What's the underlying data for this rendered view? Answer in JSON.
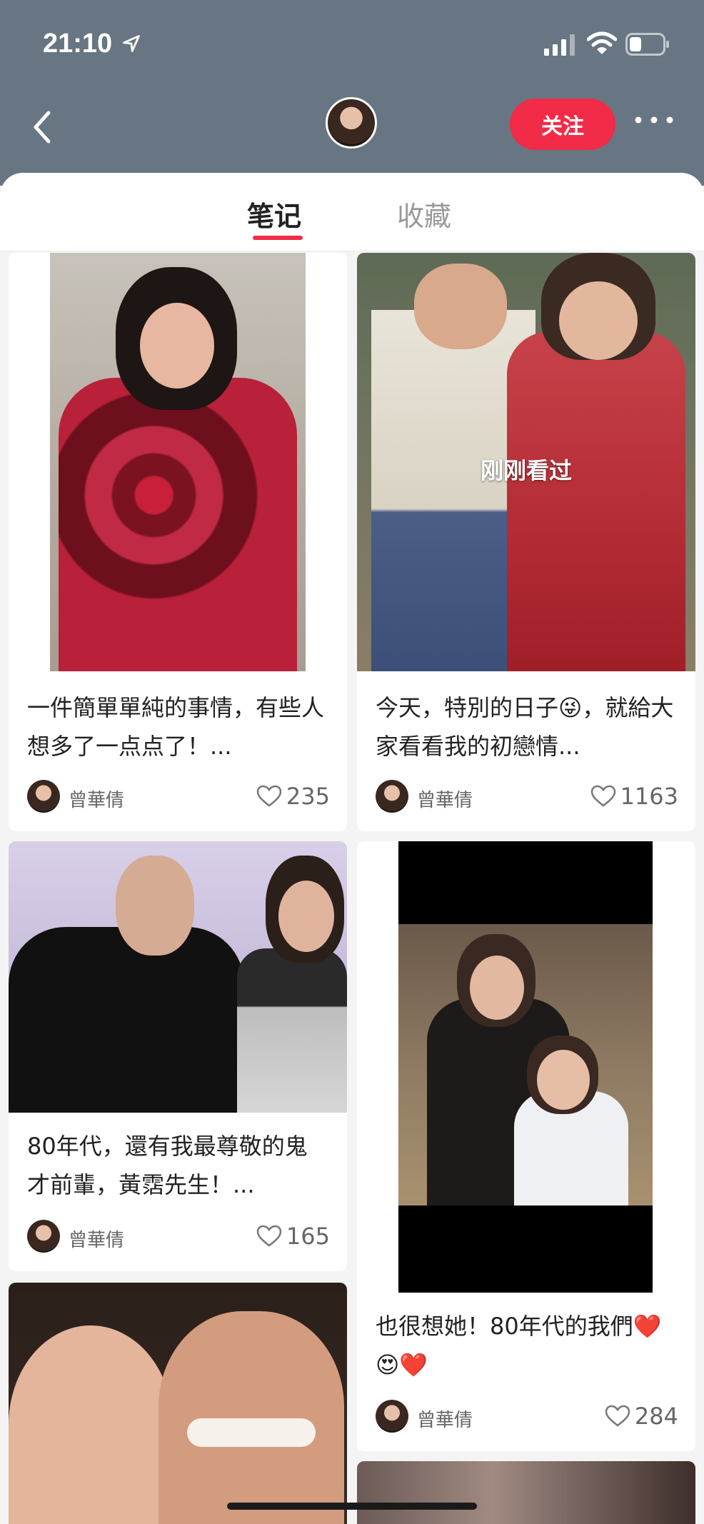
{
  "status_bar": {
    "time": "21:10"
  },
  "header": {
    "follow_label": "关注"
  },
  "tabs": [
    {
      "label": "笔记",
      "active": true
    },
    {
      "label": "收藏",
      "active": false
    }
  ],
  "notes": [
    {
      "title": "一件簡單單純的事情，有些人想多了一点点了！...",
      "author": "曾華倩",
      "likes": "235"
    },
    {
      "title": "今天，特別的日子😜，就給大家看看我的初戀情...",
      "author": "曾華倩",
      "likes": "1163",
      "overlay": "刚刚看过"
    },
    {
      "title": "80年代，還有我最尊敬的鬼才前輩，黃霑先生！...",
      "author": "曾華倩",
      "likes": "165"
    },
    {
      "title": "也很想她！80年代的我們❤️😍❤️",
      "author": "曾華倩",
      "likes": "284"
    }
  ],
  "colors": {
    "accent": "#f12b48",
    "header_bg": "#677682"
  }
}
